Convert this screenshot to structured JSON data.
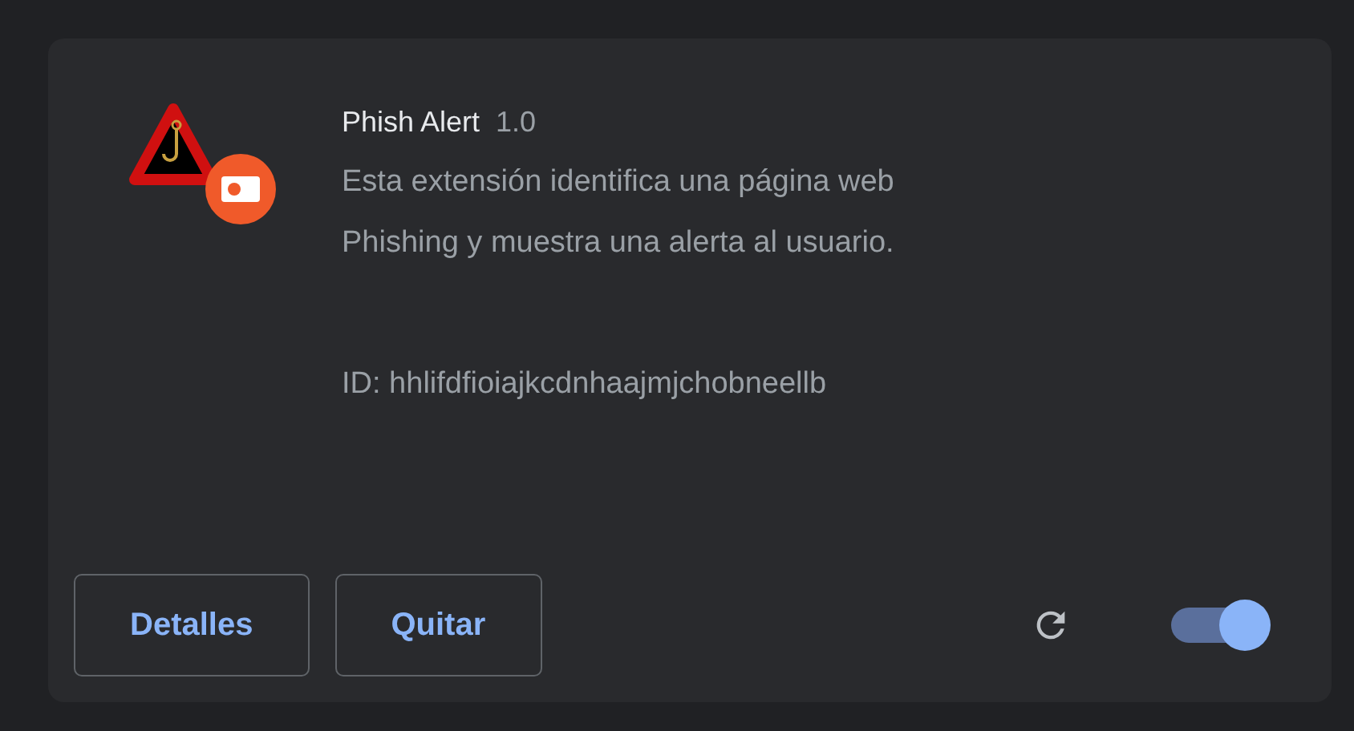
{
  "extension": {
    "name": "Phish Alert",
    "version": "1.0",
    "description": "Esta extensión identifica una página web Phishing y muestra una alerta al usuario.",
    "id": "ID: hhlifdfioiajkcdnhaajmjchobneellb"
  },
  "buttons": [
    {
      "label": "Detalles"
    },
    {
      "label": "Quitar"
    }
  ],
  "toggle": {
    "on": true
  }
}
